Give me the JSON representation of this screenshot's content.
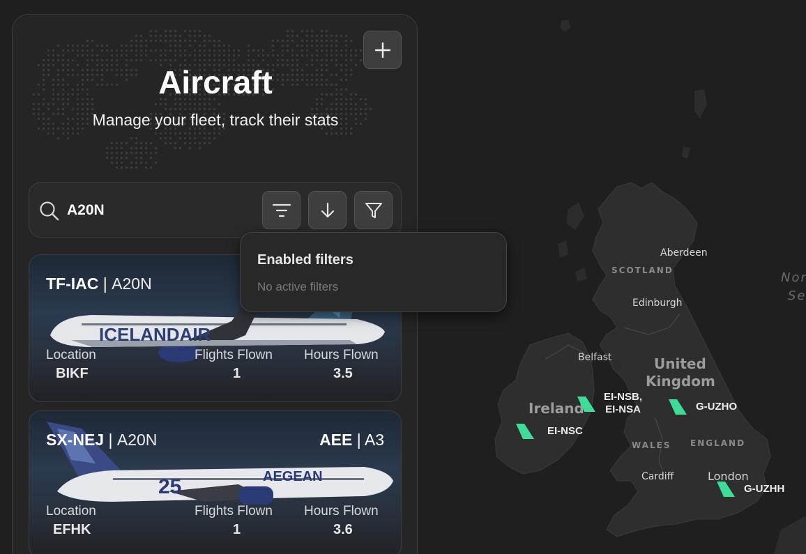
{
  "panel": {
    "title": "Aircraft",
    "subtitle": "Manage your fleet, track their stats",
    "add_icon": "plus-icon"
  },
  "search": {
    "value": "A20N",
    "icon": "search-icon",
    "sort_options_icon": "sort-lines-icon",
    "sort_direction_icon": "arrow-down-icon",
    "filter_icon": "funnel-icon"
  },
  "filter_popover": {
    "title": "Enabled filters",
    "empty_text": "No active filters"
  },
  "aircraft": [
    {
      "registration": "TF-IAC",
      "separator": "|",
      "type": "A20N",
      "airline_code": "",
      "airline_type": "",
      "livery_text": "ICELANDAIR",
      "location_label": "Location",
      "location": "BIKF",
      "flights_label": "Flights Flown",
      "flights": "1",
      "hours_label": "Hours Flown",
      "hours": "3.5"
    },
    {
      "registration": "SX-NEJ",
      "separator": "|",
      "type": "A20N",
      "airline_code": "AEE",
      "airline_type": "A3",
      "livery_text": "AEGEAN",
      "location_label": "Location",
      "location": "EFHK",
      "flights_label": "Flights Flown",
      "flights": "1",
      "hours_label": "Hours Flown",
      "hours": "3.6"
    }
  ],
  "map": {
    "cities": [
      "Aberdeen",
      "Edinburgh",
      "Belfast",
      "Cardiff",
      "London"
    ],
    "regions": [
      "SCOTLAND",
      "WALES",
      "ENGLAND"
    ],
    "countries": [
      "Ireland",
      "United",
      "Kingdom"
    ],
    "sea": [
      "Nor",
      "Se"
    ],
    "planes": [
      {
        "label_line1": "EI-NSB,",
        "label_line2": "EI-NSA"
      },
      {
        "label_line1": "G-UZHO"
      },
      {
        "label_line1": "EI-NSC"
      },
      {
        "label_line1": "G-UZHH"
      }
    ],
    "marker_color": "#3ddc97"
  },
  "colors": {
    "background": "#1f1f1f",
    "panel": "#252525",
    "land": "#2e2e2e",
    "accent": "#3ddc97"
  }
}
